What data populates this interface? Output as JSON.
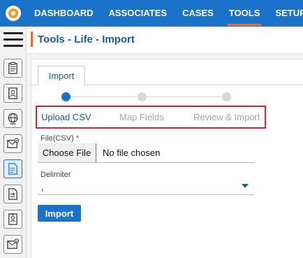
{
  "topnav": {
    "items": [
      {
        "label": "DASHBOARD",
        "active": false
      },
      {
        "label": "ASSOCIATES",
        "active": false
      },
      {
        "label": "CASES",
        "active": false
      },
      {
        "label": "TOOLS",
        "active": true
      },
      {
        "label": "SETUP",
        "active": false
      }
    ]
  },
  "sidebar": {
    "icons": [
      "clipboard-icon",
      "contact-book-icon",
      "globe-icon",
      "mail-check-icon",
      "document-edit-icon",
      "document-arrow-icon",
      "id-badge-icon",
      "mail-check-icon"
    ],
    "active_index": 4
  },
  "page": {
    "title": "Tools - Life - Import"
  },
  "tab": {
    "label": "Import"
  },
  "stepper": {
    "steps": [
      {
        "label": "Upload CSV",
        "active": true
      },
      {
        "label": "Map Fields",
        "active": false
      },
      {
        "label": "Review & Import",
        "active": false
      }
    ]
  },
  "form": {
    "file_label": "File(CSV)",
    "required_mark": "*",
    "choose_file_label": "Choose File",
    "file_status": "No file chosen",
    "delimiter_label": "Delimiter",
    "delimiter_value": ",",
    "submit_label": "Import"
  },
  "colors": {
    "primary": "#1a73c9",
    "accent": "#f06a35",
    "highlight_box": "#d9252f"
  }
}
